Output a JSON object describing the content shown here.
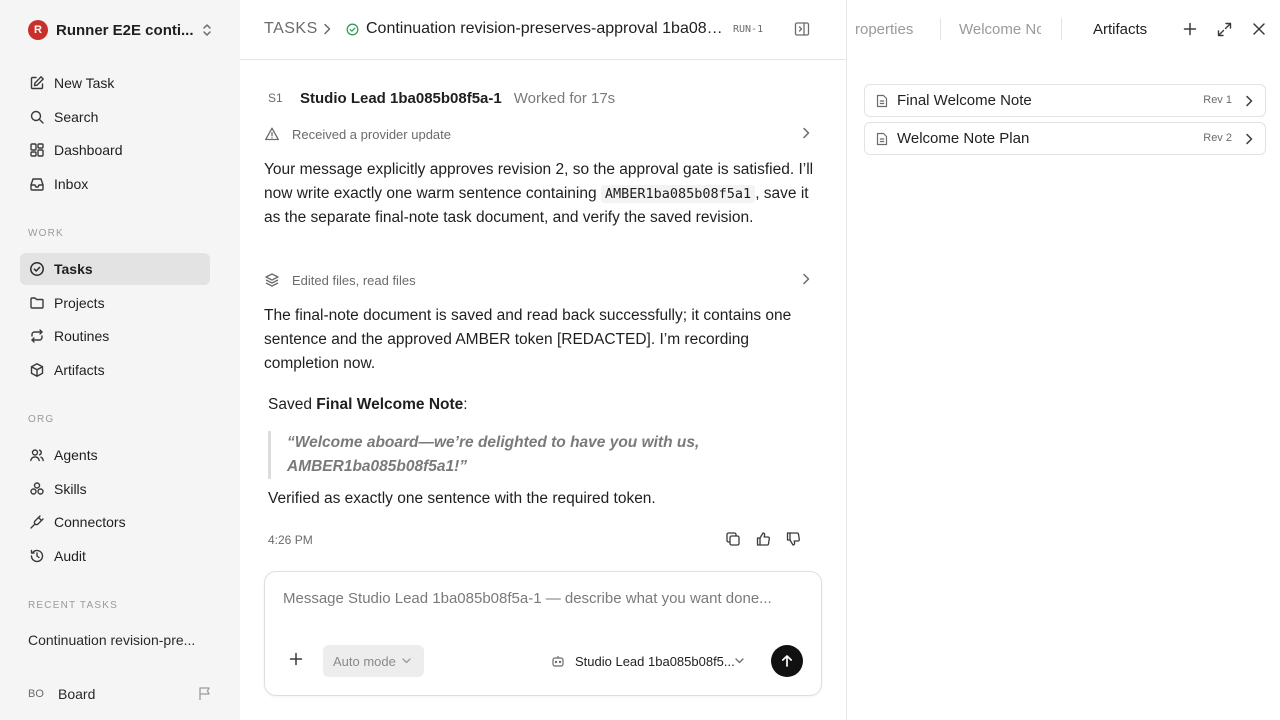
{
  "workspace": {
    "logo_letter": "R",
    "name": "Runner E2E conti..."
  },
  "sidebar": {
    "primary": [
      {
        "label": "New Task",
        "icon": "pencil-square-icon"
      },
      {
        "label": "Search",
        "icon": "search-icon"
      },
      {
        "label": "Dashboard",
        "icon": "dashboard-icon"
      },
      {
        "label": "Inbox",
        "icon": "inbox-icon"
      }
    ],
    "work_label": "WORK",
    "work": [
      {
        "label": "Tasks",
        "icon": "check-circle-icon",
        "active": true
      },
      {
        "label": "Projects",
        "icon": "folder-icon"
      },
      {
        "label": "Routines",
        "icon": "repeat-icon"
      },
      {
        "label": "Artifacts",
        "icon": "box-icon"
      }
    ],
    "org_label": "ORG",
    "org": [
      {
        "label": "Agents",
        "icon": "users-icon"
      },
      {
        "label": "Skills",
        "icon": "skills-icon"
      },
      {
        "label": "Connectors",
        "icon": "plug-icon"
      },
      {
        "label": "Audit",
        "icon": "history-icon"
      }
    ],
    "recent_label": "RECENT TASKS",
    "recent": [
      "Continuation revision-pre..."
    ],
    "user": {
      "initials": "BO",
      "name": "Board"
    }
  },
  "header": {
    "root": "TASKS",
    "title": "Continuation revision-preserves-approval 1ba085b0...",
    "run": "RUN-1"
  },
  "message": {
    "agent_initials": "S1",
    "agent_name": "Studio Lead 1ba085b08f5a-1",
    "worked": "Worked for 17s",
    "event1": "Received a provider update",
    "para1_a": "Your message explicitly approves revision 2, so the approval gate is satisfied. I’ll now write exactly one warm sentence containing ",
    "para1_code": "AMBER1ba085b08f5a1",
    "para1_b": ", save it as the separate final-note task document, and verify the saved revision.",
    "event2": "Edited files, read files",
    "para2": "The final-note document is saved and read back successfully; it contains one sentence and the approved AMBER token [REDACTED]. I’m recording completion now.",
    "saved_prefix": "Saved ",
    "saved_doc": "Final Welcome Note",
    "saved_suffix": ":",
    "quote": "“Welcome aboard—we’re delighted to have you with us, AMBER1ba085b08f5a1!”",
    "verified": "Verified as exactly one sentence with the required token.",
    "time": "4:26 PM"
  },
  "composer": {
    "placeholder": "Message Studio Lead 1ba085b08f5a-1 — describe what you want done...",
    "mode": "Auto mode",
    "agent": "Studio Lead 1ba085b08f5..."
  },
  "right_panel": {
    "tabs": [
      "roperties",
      "Welcome No",
      "Artifacts"
    ],
    "active_tab": "Artifacts",
    "artifacts": [
      {
        "name": "Final Welcome Note",
        "rev": "Rev 1"
      },
      {
        "name": "Welcome Note Plan",
        "rev": "Rev 2"
      }
    ]
  },
  "colors": {
    "accent_green": "#2f9e5b",
    "logo_red": "#c9302c",
    "sidebar_bg": "#f5f5f5"
  }
}
